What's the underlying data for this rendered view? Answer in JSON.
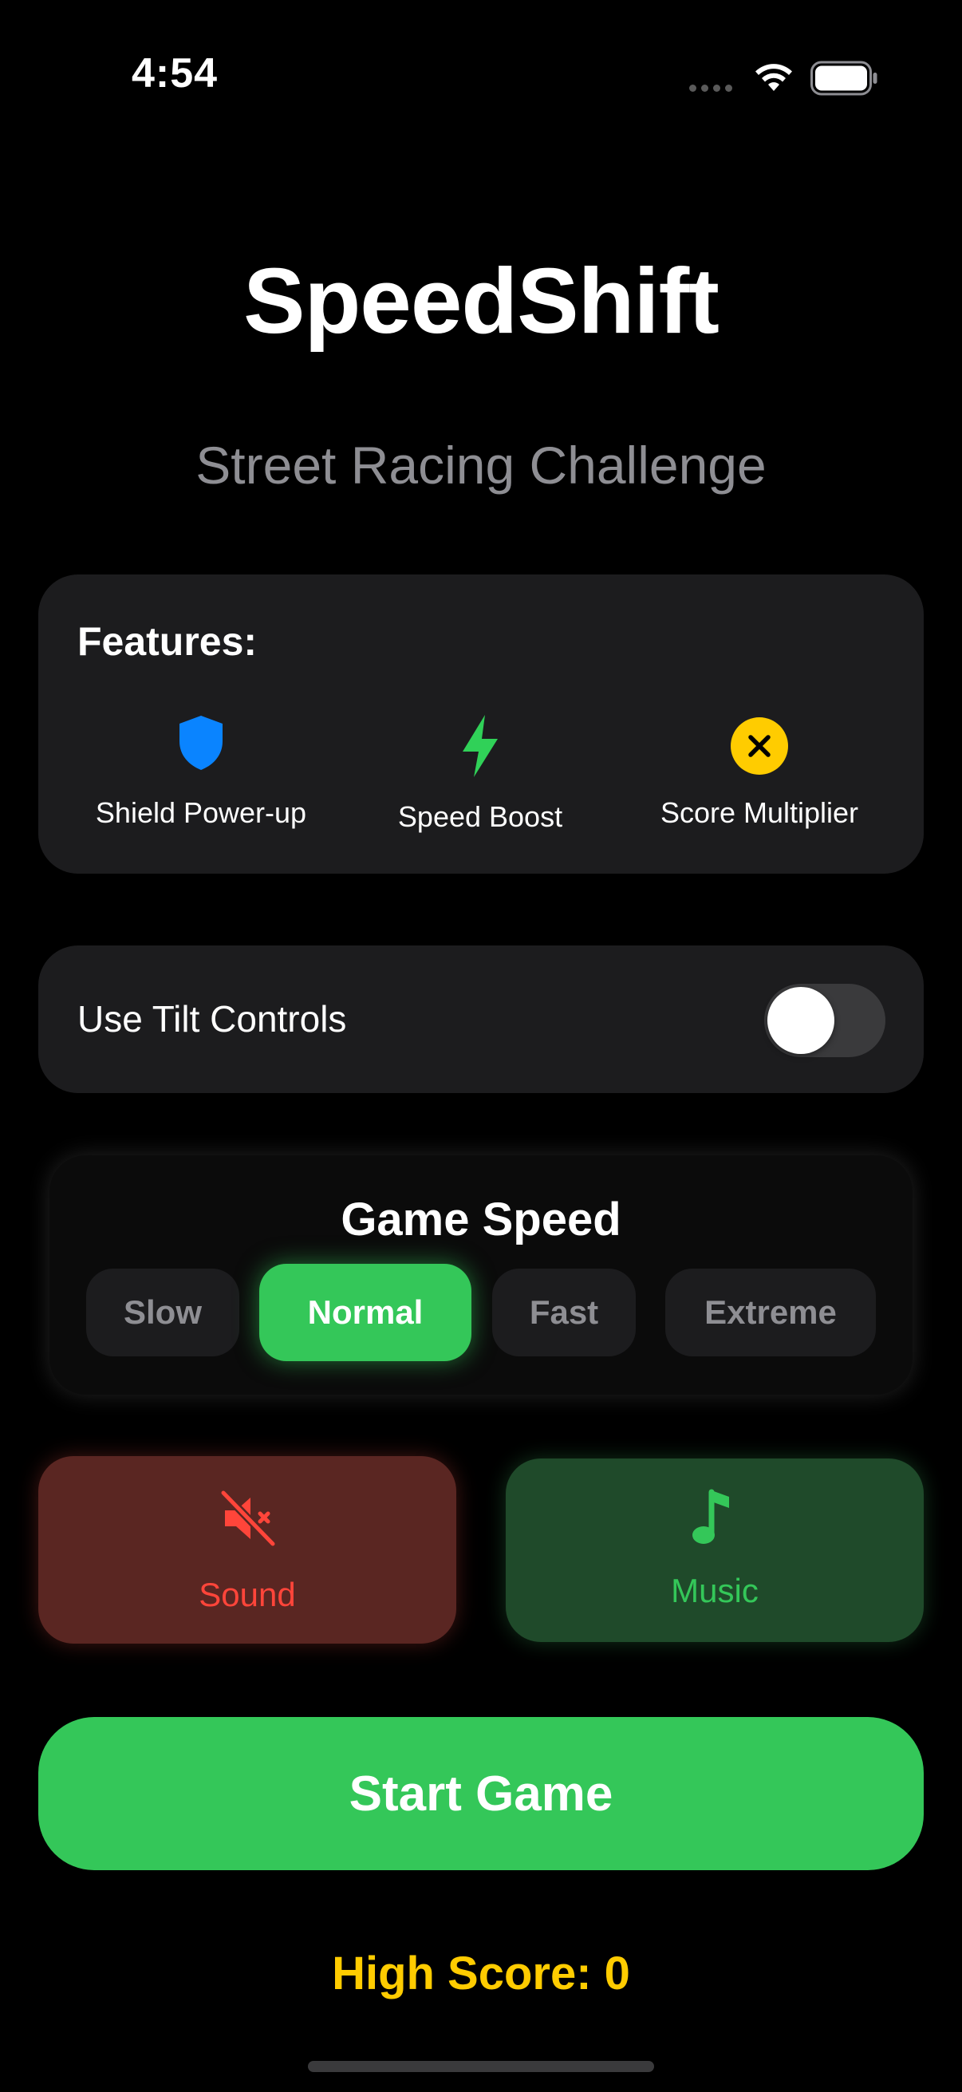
{
  "status_bar": {
    "time": "4:54"
  },
  "app": {
    "title": "SpeedShift",
    "subtitle": "Street Racing Challenge"
  },
  "features": {
    "heading": "Features:",
    "items": [
      {
        "label": "Shield Power-up",
        "icon": "shield-icon",
        "color": "#0a84ff"
      },
      {
        "label": "Speed Boost",
        "icon": "lightning-bolt-icon",
        "color": "#30d158"
      },
      {
        "label": "Score Multiplier",
        "icon": "multiply-circle-icon",
        "color": "#ffcc00"
      }
    ]
  },
  "tilt": {
    "label": "Use Tilt Controls",
    "enabled": false
  },
  "game_speed": {
    "heading": "Game Speed",
    "options": [
      "Slow",
      "Normal",
      "Fast",
      "Extreme"
    ],
    "selected": "Normal"
  },
  "audio": {
    "sound": {
      "label": "Sound",
      "icon": "speaker-muted-icon",
      "enabled": false,
      "color": "#ff453a"
    },
    "music": {
      "label": "Music",
      "icon": "music-note-icon",
      "enabled": true,
      "color": "#34c759"
    }
  },
  "start_button": {
    "label": "Start Game"
  },
  "high_score": {
    "text": "High Score: 0"
  },
  "colors": {
    "accent_green": "#34c759",
    "card_bg": "#1c1c1e",
    "score_yellow": "#ffcc00"
  }
}
